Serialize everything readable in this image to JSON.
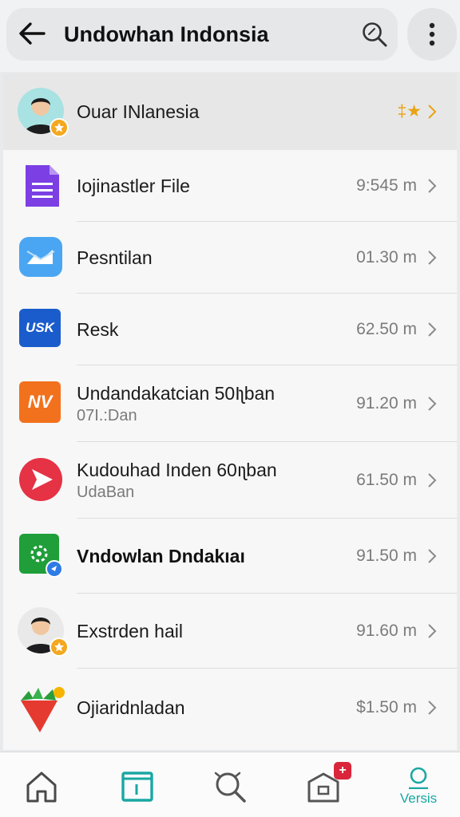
{
  "header": {
    "title": "Undowhan Indonsia",
    "back_icon": "arrow-left-icon",
    "search_icon": "search-icon",
    "more_icon": "more-vertical-icon"
  },
  "list": {
    "profile": {
      "name": "Ouar INlanesia",
      "badges": "‡★"
    },
    "items": [
      {
        "title": "Iojinastler File",
        "meta": "9:545 m",
        "icon": "document-icon"
      },
      {
        "title": "Pesntilan",
        "meta": "01.30 m",
        "icon": "mail-icon"
      },
      {
        "title": "Resk",
        "meta": "62.50 m",
        "icon": "usk-logo-icon",
        "icon_text": "USK"
      },
      {
        "title": "Undandakatcian 50Iʅban",
        "subtitle": "07I.:Dan",
        "meta": "91.20 m",
        "icon": "nv-logo-icon",
        "icon_text": "NV"
      },
      {
        "title": "Kudouhad Inden 60ıʅban",
        "subtitle": "UdaBan",
        "meta": "61.50 m",
        "icon": "play-icon"
      },
      {
        "title": "Vndowlan Dndakıaı",
        "meta": "91.50 m",
        "icon": "gear-icon"
      },
      {
        "title": "Exstrden hail",
        "meta": "91.60 m",
        "icon": "avatar-icon"
      },
      {
        "title": "Ojiaridnladan",
        "meta": "$1.50 m",
        "icon": "flower-icon"
      }
    ]
  },
  "bottom_nav": {
    "items": [
      {
        "icon": "home-icon"
      },
      {
        "icon": "folder-icon"
      },
      {
        "icon": "search-icon"
      },
      {
        "icon": "inbox-icon",
        "badge": "+"
      },
      {
        "icon": "profile-icon",
        "label": "Versis"
      }
    ]
  },
  "colors": {
    "accent": "#1aa7a3",
    "star": "#f4a820"
  }
}
